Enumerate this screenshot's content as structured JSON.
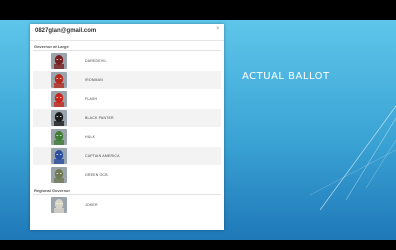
{
  "slide": {
    "title": "ACTUAL BALLOT"
  },
  "ballot": {
    "email": "0827glan@gmail.com",
    "close_glyph": "×",
    "sections": [
      {
        "label": "Governor at Large",
        "candidates": [
          {
            "name": "DAREDEVIL",
            "avatar_icon": "daredevil-avatar",
            "color": "#7a1f1f"
          },
          {
            "name": "IRONMAN",
            "avatar_icon": "ironman-avatar",
            "color": "#b52a1d"
          },
          {
            "name": "FLASH",
            "avatar_icon": "flash-avatar",
            "color": "#c8261d"
          },
          {
            "name": "BLACK PANTER",
            "avatar_icon": "black-panther-avatar",
            "color": "#1b1b1b"
          },
          {
            "name": "HULK",
            "avatar_icon": "hulk-avatar",
            "color": "#3f7d32"
          },
          {
            "name": "CAPTAIN AMERICA",
            "avatar_icon": "captain-america-avatar",
            "color": "#2b4f9e"
          },
          {
            "name": "GREEN OCB",
            "avatar_icon": "green-ocb-avatar",
            "color": "#6f7a52"
          }
        ]
      },
      {
        "label": "Regional Governor",
        "candidates": [
          {
            "name": "JOKER",
            "avatar_icon": "joker-avatar",
            "color": "#d9d4c8"
          }
        ]
      }
    ]
  }
}
